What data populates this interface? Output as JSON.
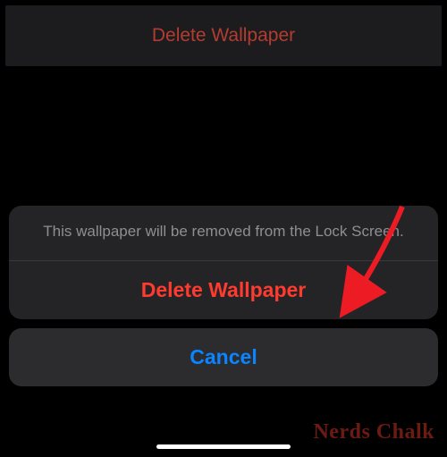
{
  "top_bar": {
    "title": "Delete Wallpaper"
  },
  "action_sheet": {
    "message": "This wallpaper will be removed from the Lock Screen.",
    "delete_label": "Delete Wallpaper",
    "cancel_label": "Cancel"
  },
  "watermark": "Nerds Chalk"
}
